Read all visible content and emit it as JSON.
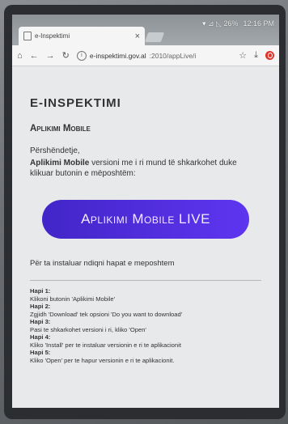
{
  "status_bar": {
    "indicators": "▾  ⊿  ◺ 26%",
    "time": "12:16 PM"
  },
  "tab": {
    "title": "e-Inspektimi",
    "close": "×"
  },
  "toolbar": {
    "url_host": "e-inspektimi.gov.al",
    "url_rest": ":2010/appLive/i"
  },
  "page": {
    "brand": "E-INSPEKTIMI",
    "heading": "Aplikimi Mobile",
    "greeting": "Përshëndetje,",
    "desc_bold": "Aplikimi Mobile",
    "desc_rest": " versioni me i ri mund të shkarkohet duke klikuar butonin e mëposhtëm:",
    "cta_label": "Aplikimi Mobile LIVE",
    "install_text": "Për ta instaluar ndiqni hapat e meposhtem",
    "steps": [
      {
        "title": "Hapi 1:",
        "text": "Klikoni butonin 'Aplikimi Mobile'"
      },
      {
        "title": "Hapi 2:",
        "text": "Zgjidh 'Download' tek opsioni 'Do you want to download'"
      },
      {
        "title": "Hapi 3:",
        "text": "Pasi te shkarkohet versioni i ri, kliko 'Open'"
      },
      {
        "title": "Hapi 4:",
        "text": "Kliko 'Install' per te instaluar versionin e ri te aplikacionit"
      },
      {
        "title": "Hapi 5:",
        "text": "Kliko 'Open' per te hapur versionin e ri te aplikacionit."
      }
    ]
  }
}
